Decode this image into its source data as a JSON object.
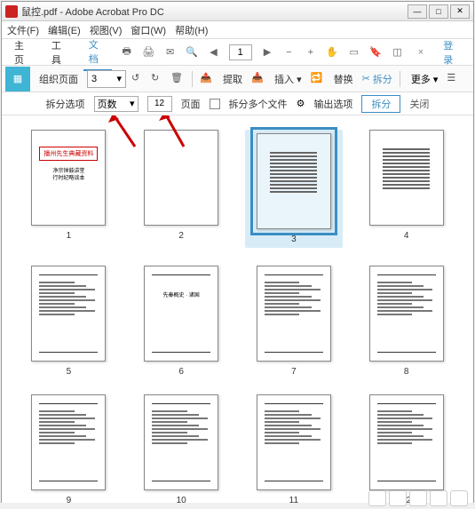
{
  "window": {
    "doc_name": "鼠控.pdf",
    "app_name": "Adobe Acrobat Pro DC"
  },
  "title_sep": " - ",
  "win_controls": {
    "min": "—",
    "max": "□",
    "close": "✕"
  },
  "menubar": [
    "文件(F)",
    "编辑(E)",
    "视图(V)",
    "窗口(W)",
    "帮助(H)"
  ],
  "topbar": {
    "tabs": [
      "主页",
      "工具",
      "文档"
    ],
    "active_tab": 2,
    "page_input": "1",
    "login": "登录",
    "close_x": "×"
  },
  "toolbar2": {
    "organize": "组织页面",
    "page_dd": "3",
    "extract": "提取",
    "insert": "插入",
    "replace": "替换",
    "split": "拆分",
    "more": "更多",
    "dd_arrow": "▾",
    "scissors_glyph": "✂"
  },
  "optbar": {
    "split_opt": "拆分选项",
    "mode_dd": "页数",
    "num_value": "12",
    "pages_lbl": "页面",
    "multi_files": "拆分多个文件",
    "output_opt": "输出选项",
    "split_btn": "拆分",
    "close_btn": "关闭",
    "dd_arrow": "▾",
    "gear_glyph": "⚙"
  },
  "thumbnails": {
    "count": 12,
    "selected": 3,
    "page1": {
      "title": "播州先生典藏资料",
      "sub1": "净宗钟鼓讲堂",
      "sub2": "行时纪略谈本"
    },
    "page6_text": "先秦概史 · 诸国"
  },
  "chart_data": null
}
